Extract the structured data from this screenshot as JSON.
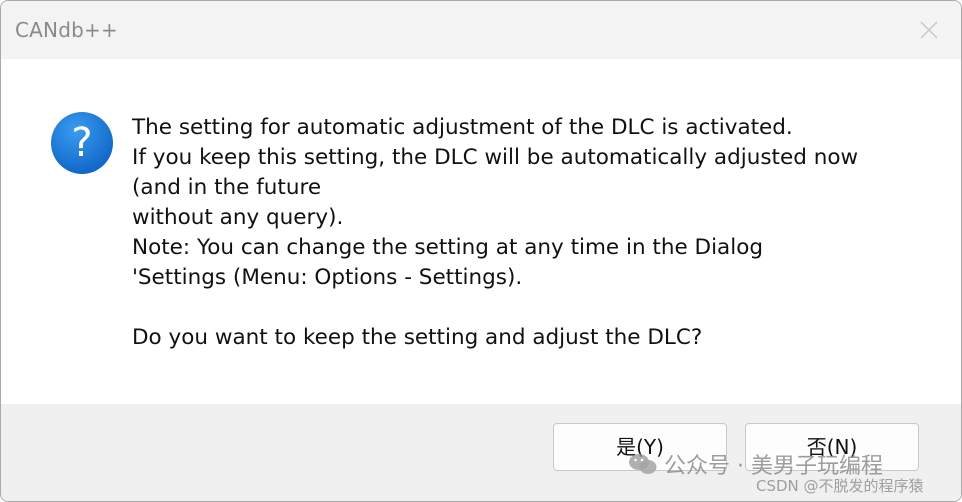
{
  "window": {
    "title": "CANdb++"
  },
  "dialog": {
    "icon": "question-icon",
    "message_lines": [
      "The setting for automatic adjustment of the DLC is activated.",
      "If you keep this setting, the DLC will be automatically adjusted now",
      "(and in the future",
      "without any query).",
      "Note: You can change the setting at any time in the Dialog",
      "'Settings (Menu: Options - Settings).",
      "",
      "Do you want to keep the setting and adjust the DLC?"
    ],
    "buttons": {
      "yes_label": "是(Y)",
      "no_label": "否(N)"
    }
  },
  "watermarks": {
    "wechat": "公众号 · 美男子玩编程",
    "csdn": "CSDN @不脱发的程序猿"
  },
  "colors": {
    "titlebar_bg": "#f3f3f3",
    "footer_bg": "#f0f0f0",
    "icon_blue": "#1b78d6"
  }
}
